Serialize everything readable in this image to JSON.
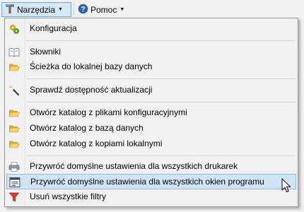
{
  "menubar": {
    "tools": {
      "label": "Narzędzia",
      "icon": "hammer-icon"
    },
    "help": {
      "label": "Pomoc",
      "icon": "help-icon"
    }
  },
  "menu": {
    "items": [
      {
        "id": "konfiguracja",
        "label": "Konfiguracja",
        "icon": "settings-icon"
      },
      {
        "id": "slowniki",
        "label": "Słowniki",
        "icon": "book-icon"
      },
      {
        "id": "sciezka",
        "label": "Ścieżka do lokalnej bazy danych",
        "icon": "folder-open-icon"
      },
      {
        "id": "aktualizacje",
        "label": "Sprawdź dostępność aktualizacji",
        "icon": "magic-wand-icon"
      },
      {
        "id": "katalog-konfig",
        "label": "Otwórz katalog z plikami konfiguracyjnymi",
        "icon": "folder-open-icon"
      },
      {
        "id": "katalog-baza",
        "label": "Otwórz katalog z bazą danych",
        "icon": "folder-open-icon"
      },
      {
        "id": "katalog-kopie",
        "label": "Otwórz katalog z kopiami lokalnymi",
        "icon": "folder-open-icon"
      },
      {
        "id": "reset-drukarki",
        "label": "Przywróć domyślne ustawienia dla wszystkich drukarek",
        "icon": "printer-icon"
      },
      {
        "id": "reset-okna",
        "label": "Przywróć domyślne ustawienia dla wszystkich okien programu",
        "icon": "window-settings-icon"
      },
      {
        "id": "usun-filtry",
        "label": "Usuń wszystkie filtry",
        "icon": "filter-icon"
      }
    ],
    "highlighted": "reset-okna"
  },
  "colors": {
    "highlight_bg": "#d0e3f7",
    "highlight_border": "#90b9e6",
    "folder": "#f2c94c"
  }
}
